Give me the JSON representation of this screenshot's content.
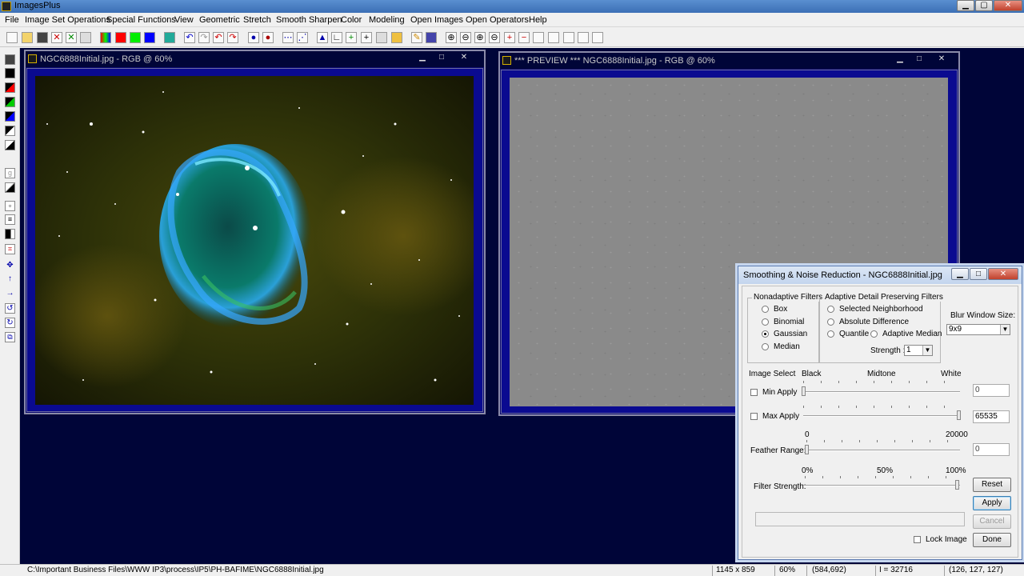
{
  "app": {
    "title": "ImagesPlus"
  },
  "menu": [
    "File",
    "Image Set Operations",
    "Special Functions",
    "View",
    "Geometric",
    "Stretch",
    "Smooth Sharpen",
    "Color",
    "Modeling",
    "Open Images",
    "Open Operators",
    "Help"
  ],
  "image_window": {
    "title": "NGC6888Initial.jpg - RGB @ 60%"
  },
  "preview_window": {
    "title": "*** PREVIEW *** NGC6888Initial.jpg - RGB @ 60%"
  },
  "dialog": {
    "title": "Smoothing & Noise Reduction - NGC6888Initial.jpg",
    "nonadaptive": {
      "label": "Nonadaptive Filters",
      "options": [
        "Box",
        "Binomial",
        "Gaussian",
        "Median"
      ],
      "selected": "Gaussian"
    },
    "adaptive": {
      "label": "Adaptive Detail Preserving Filters",
      "options": [
        "Selected Neighborhood",
        "Absolute Difference",
        "Quantile",
        "Adaptive Median"
      ],
      "strength_label": "Strength :",
      "strength_value": "1"
    },
    "blur": {
      "label": "Blur Window Size:",
      "value": "9x9"
    },
    "image_select": {
      "label": "Image Select",
      "black": "Black",
      "midtone": "Midtone",
      "white": "White"
    },
    "min_apply": {
      "label": "Min Apply",
      "value": "0",
      "checked": false,
      "level": 0
    },
    "max_apply": {
      "label": "Max Apply",
      "value": "65535",
      "checked": false,
      "level": 1
    },
    "feather": {
      "label": "Feather Range:",
      "min": "0",
      "max": "20000",
      "value": "0",
      "level": 0
    },
    "filter_strength": {
      "label": "Filter Strength:",
      "min": "0%",
      "mid": "50%",
      "max": "100%",
      "level": 1
    },
    "buttons": {
      "reset": "Reset",
      "apply": "Apply",
      "cancel": "Cancel",
      "done": "Done"
    },
    "lock_image": {
      "label": "Lock Image",
      "checked": false
    }
  },
  "status": {
    "path": "C:\\Important Business Files\\WWW IP3\\process\\IP5\\PH-BAFIME\\NGC6888Initial.jpg",
    "size": "1145 x 859",
    "zoom": "60%",
    "coords": "(584,692)",
    "intensity": "I = 32716",
    "rgb": "(126, 127, 127)"
  }
}
